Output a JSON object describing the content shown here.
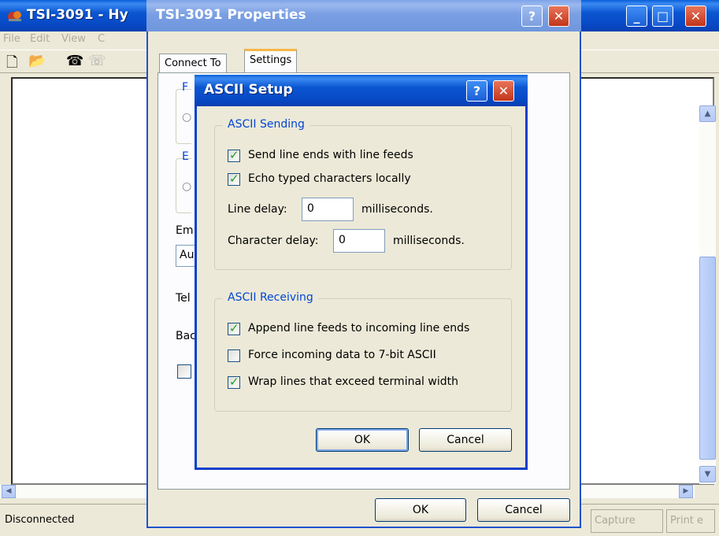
{
  "main": {
    "title": "TSI-3091 - Hy",
    "menu": [
      "File",
      "Edit",
      "View",
      "C"
    ],
    "status": {
      "connection": "Disconnected",
      "capture": "Capture",
      "print": "Print e"
    }
  },
  "props": {
    "title": "TSI-3091 Properties",
    "tabs": [
      "Connect To",
      "Settings"
    ],
    "partial_labels": [
      "F",
      "E",
      "Em",
      "Au",
      "Tel",
      "Bac"
    ],
    "ok": "OK",
    "cancel": "Cancel"
  },
  "ascii": {
    "title": "ASCII Setup",
    "sending": {
      "legend": "ASCII Sending",
      "send_line_ends": {
        "label": "Send line ends with line feeds",
        "checked": true
      },
      "echo_local": {
        "label": "Echo typed characters locally",
        "checked": true
      },
      "line_delay_label": "Line delay:",
      "line_delay_value": "0",
      "line_delay_unit": "milliseconds.",
      "char_delay_label": "Character delay:",
      "char_delay_value": "0",
      "char_delay_unit": "milliseconds."
    },
    "receiving": {
      "legend": "ASCII Receiving",
      "append_line_feeds": {
        "label": "Append line feeds to incoming line ends",
        "checked": true
      },
      "force_7bit": {
        "label": "Force incoming data to 7-bit ASCII",
        "checked": false
      },
      "wrap_lines": {
        "label": "Wrap lines that exceed terminal width",
        "checked": true
      }
    },
    "ok": "OK",
    "cancel": "Cancel"
  },
  "icons": {
    "help": "?",
    "close": "✕",
    "minimize": "_",
    "maximize": "□",
    "check": "✓"
  },
  "colors": {
    "title_active": "#0a56d1",
    "title_inactive": "#7a9fe3",
    "group_legend": "#0046d5",
    "check": "#21a121"
  }
}
